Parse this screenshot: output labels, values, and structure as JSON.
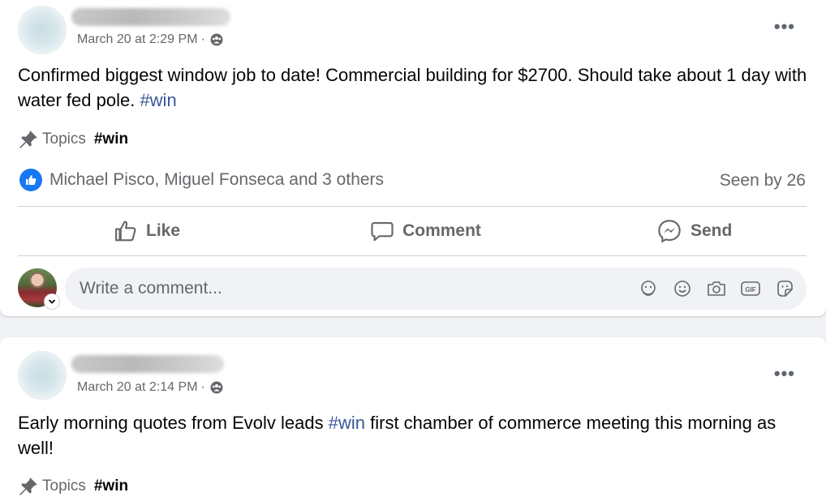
{
  "posts": [
    {
      "timestamp": "March 20 at 2:29 PM",
      "separator": "·",
      "privacy_icon": "group-members-icon",
      "text_before": "Confirmed biggest window job to date! Commercial building for $2700. Should take about 1 day with water fed pole.",
      "hashtag": "#win",
      "text_after": "",
      "topics_label": "Topics",
      "topic_tag": "#win",
      "reactions_text": "Michael Pisco, Miguel Fonseca and 3 others",
      "seen_by": "Seen by 26",
      "actions": {
        "like": "Like",
        "comment": "Comment",
        "send": "Send"
      },
      "comment_placeholder": "Write a comment..."
    },
    {
      "timestamp": "March 20 at 2:14 PM",
      "separator": "·",
      "privacy_icon": "group-members-icon",
      "text_before": "Early morning quotes from Evolv leads",
      "hashtag": "#win",
      "text_after": "first chamber of commerce meeting this morning as well!",
      "topics_label": "Topics",
      "topic_tag": "#win"
    }
  ],
  "colors": {
    "link": "#385898",
    "secondary_text": "#65676b",
    "like_blue": "#1877f2",
    "background": "#f0f2f5"
  }
}
